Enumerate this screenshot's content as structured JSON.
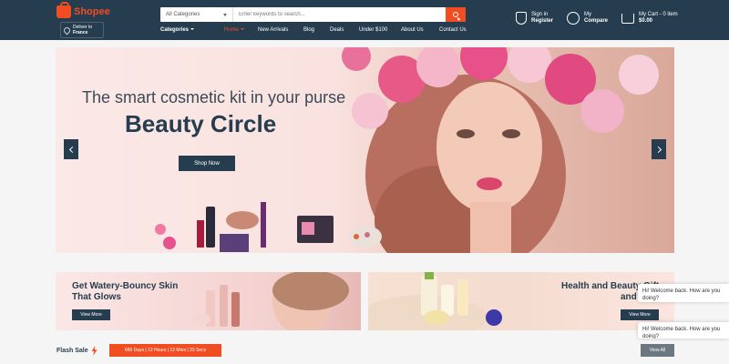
{
  "header": {
    "logo_text": "Shopee",
    "deliver_label": "Deliver to",
    "deliver_country": "France",
    "search": {
      "category": "All Categories",
      "placeholder": "Enter keywords to search..."
    },
    "nav": [
      {
        "label": "Categories"
      },
      {
        "label": "Home"
      },
      {
        "label": "New Arrivals"
      },
      {
        "label": "Blog"
      },
      {
        "label": "Deals"
      },
      {
        "label": "Under $100"
      },
      {
        "label": "About Us"
      },
      {
        "label": "Contact Us"
      }
    ],
    "signin_line1": "Sign in",
    "signin_line2": "Register",
    "compare_line1": "My",
    "compare_line2": "Compare",
    "cart_line1": "My Cart - 0 item",
    "cart_line2": "$0.00"
  },
  "hero": {
    "subtitle": "The smart cosmetic kit in your purse",
    "title": "Beauty Circle",
    "button": "Shop Now"
  },
  "banners": [
    {
      "title_line1": "Get Watery-Bouncy Skin",
      "title_line2": "That Glows",
      "button": "View More"
    },
    {
      "title_line1": "Health and Beauty Gift",
      "title_line2": "and Pres",
      "button": "View More"
    }
  ],
  "flash_sale": {
    "label": "Flash Sale",
    "timer": "686 Days  |  12 Hours  |  12 Mins  |  33 Secs",
    "view_all": "View All"
  },
  "chat": [
    {
      "text": "Hi! Welcome back. How are you doing?"
    },
    {
      "text": "Hi! Welcome back. How are you doing?"
    }
  ],
  "colors": {
    "header_bg": "#253d4e",
    "accent": "#f04d23"
  }
}
